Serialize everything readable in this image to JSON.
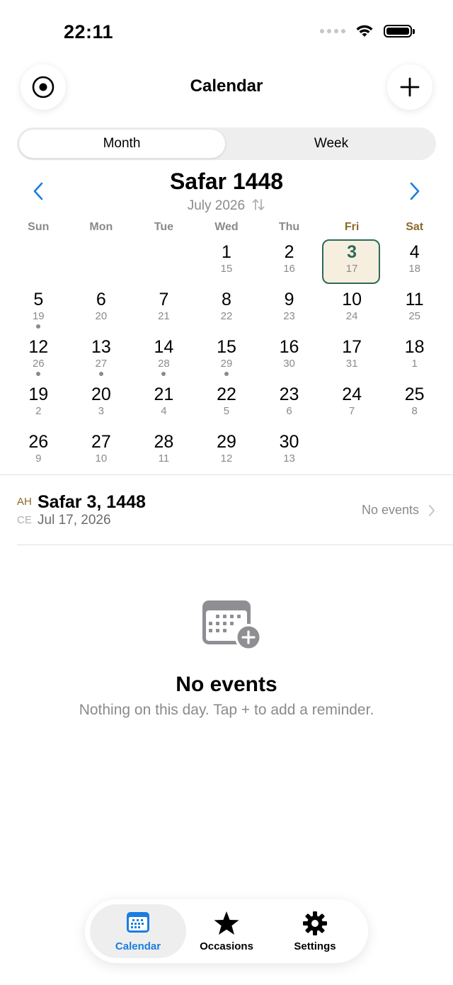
{
  "status_bar": {
    "time": "22:11"
  },
  "header": {
    "title": "Calendar",
    "left_icon": "target-icon",
    "right_icon": "plus-icon"
  },
  "view_switcher": {
    "options": [
      "Month",
      "Week"
    ],
    "selected": "Month"
  },
  "month": {
    "title": "Safar 1448",
    "subtitle": "July 2026",
    "swap_icon": "swap-arrows-icon",
    "weekdays": [
      "Sun",
      "Mon",
      "Tue",
      "Wed",
      "Thu",
      "Fri",
      "Sat"
    ],
    "days": [
      null,
      null,
      null,
      {
        "d": "1",
        "g": "15"
      },
      {
        "d": "2",
        "g": "16"
      },
      {
        "d": "3",
        "g": "17",
        "selected": true
      },
      {
        "d": "4",
        "g": "18"
      },
      {
        "d": "5",
        "g": "19",
        "dot": true
      },
      {
        "d": "6",
        "g": "20"
      },
      {
        "d": "7",
        "g": "21"
      },
      {
        "d": "8",
        "g": "22"
      },
      {
        "d": "9",
        "g": "23"
      },
      {
        "d": "10",
        "g": "24"
      },
      {
        "d": "11",
        "g": "25"
      },
      {
        "d": "12",
        "g": "26",
        "dot": true
      },
      {
        "d": "13",
        "g": "27",
        "dot": true
      },
      {
        "d": "14",
        "g": "28",
        "dot": true
      },
      {
        "d": "15",
        "g": "29",
        "dot": true
      },
      {
        "d": "16",
        "g": "30"
      },
      {
        "d": "17",
        "g": "31"
      },
      {
        "d": "18",
        "g": "1"
      },
      {
        "d": "19",
        "g": "2"
      },
      {
        "d": "20",
        "g": "3"
      },
      {
        "d": "21",
        "g": "4"
      },
      {
        "d": "22",
        "g": "5"
      },
      {
        "d": "23",
        "g": "6"
      },
      {
        "d": "24",
        "g": "7"
      },
      {
        "d": "25",
        "g": "8"
      },
      {
        "d": "26",
        "g": "9"
      },
      {
        "d": "27",
        "g": "10"
      },
      {
        "d": "28",
        "g": "11"
      },
      {
        "d": "29",
        "g": "12"
      },
      {
        "d": "30",
        "g": "13"
      }
    ]
  },
  "day_detail": {
    "ah_label": "AH",
    "ce_label": "CE",
    "ah_date": "Safar 3, 1448",
    "ce_date": "Jul 17, 2026",
    "events_summary": "No events"
  },
  "empty_state": {
    "icon": "calendar-add-icon",
    "title": "No events",
    "subtitle": "Nothing on this day. Tap + to add a reminder."
  },
  "tab_bar": {
    "tabs": [
      {
        "label": "Calendar",
        "icon": "calendar-icon",
        "active": true
      },
      {
        "label": "Occasions",
        "icon": "star-icon"
      },
      {
        "label": "Settings",
        "icon": "gear-icon"
      }
    ]
  },
  "colors": {
    "accent": "#1a7de0",
    "selected_border": "#2d6a58",
    "selected_bg": "#f6eedf",
    "weekend": "#8b6a2b"
  }
}
